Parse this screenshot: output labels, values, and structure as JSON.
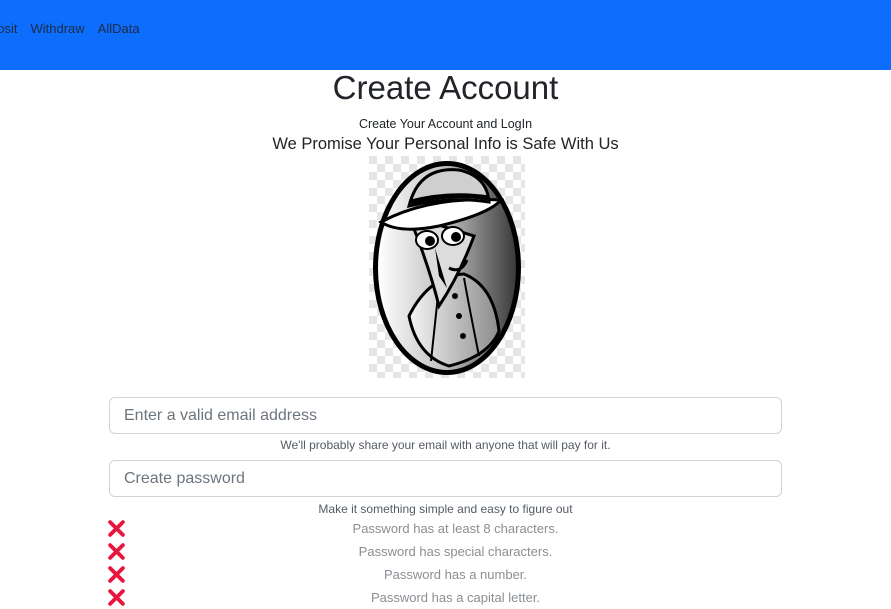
{
  "nav": {
    "links": [
      "posit",
      "Withdraw",
      "AllData"
    ]
  },
  "header": {
    "title": "Create Account",
    "subtitle": "Create Your Account and LogIn",
    "promise": "We Promise Your Personal Info is Safe With Us"
  },
  "form": {
    "email_placeholder": "Enter a valid email address",
    "email_help": "We'll probably share your email with anyone that will pay for it.",
    "password_placeholder": "Create password",
    "password_help": "Make it something simple and easy to figure out"
  },
  "rules": [
    {
      "text": "Password has at least 8 characters.",
      "met": false
    },
    {
      "text": "Password has special characters.",
      "met": false
    },
    {
      "text": "Password has a number.",
      "met": false
    },
    {
      "text": "Password has a capital letter.",
      "met": false
    }
  ],
  "colors": {
    "navbar": "#0d6efd",
    "fail_icon": "#e8163f"
  },
  "icons": {
    "rule_fail": "x-icon"
  }
}
